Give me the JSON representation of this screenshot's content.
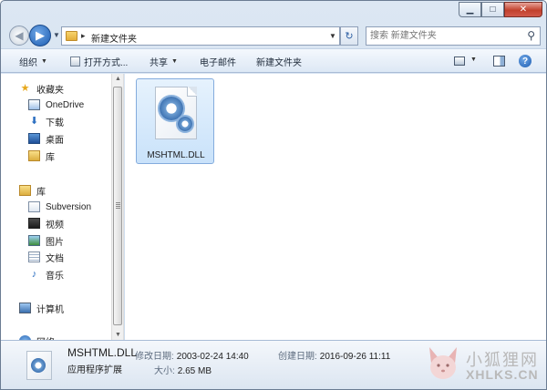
{
  "window": {
    "minimize_glyph": "▁",
    "maximize_glyph": "□",
    "close_glyph": "✕"
  },
  "address": {
    "path": "新建文件夹",
    "separator": "▸",
    "search_placeholder": "搜索 新建文件夹"
  },
  "toolbar": {
    "organize": "组织",
    "open_with": "打开方式...",
    "share": "共享",
    "email": "电子邮件",
    "new_folder": "新建文件夹",
    "help_glyph": "?"
  },
  "sidebar": {
    "favorites_header": "收藏夹",
    "favorites": [
      {
        "label": "OneDrive",
        "icon": "onedrive-icon"
      },
      {
        "label": "下载",
        "icon": "download-icon"
      },
      {
        "label": "桌面",
        "icon": "desktop-icon"
      },
      {
        "label": "库",
        "icon": "library-icon"
      }
    ],
    "libraries_header": "库",
    "libraries": [
      {
        "label": "Subversion",
        "icon": "svn-icon"
      },
      {
        "label": "视频",
        "icon": "video-icon"
      },
      {
        "label": "图片",
        "icon": "picture-icon"
      },
      {
        "label": "文档",
        "icon": "document-icon"
      },
      {
        "label": "音乐",
        "icon": "music-icon"
      }
    ],
    "computer": "计算机",
    "network": "网络"
  },
  "files": [
    {
      "name": "MSHTML.DLL",
      "icon": "dll-file-icon",
      "selected": true
    }
  ],
  "details": {
    "name": "MSHTML.DLL",
    "type": "应用程序扩展",
    "modified_label": "修改日期:",
    "modified_value": "2003-02-24 14:40",
    "created_label": "创建日期:",
    "created_value": "2016-09-26 11:11",
    "size_label": "大小:",
    "size_value": "2.65 MB"
  },
  "watermark": {
    "text_cn": "小狐狸网",
    "text_en": "XHLKS.CN"
  },
  "colors": {
    "accent": "#1d5db2",
    "selection": "#c9e2fa",
    "chrome": "#dce7f3"
  }
}
